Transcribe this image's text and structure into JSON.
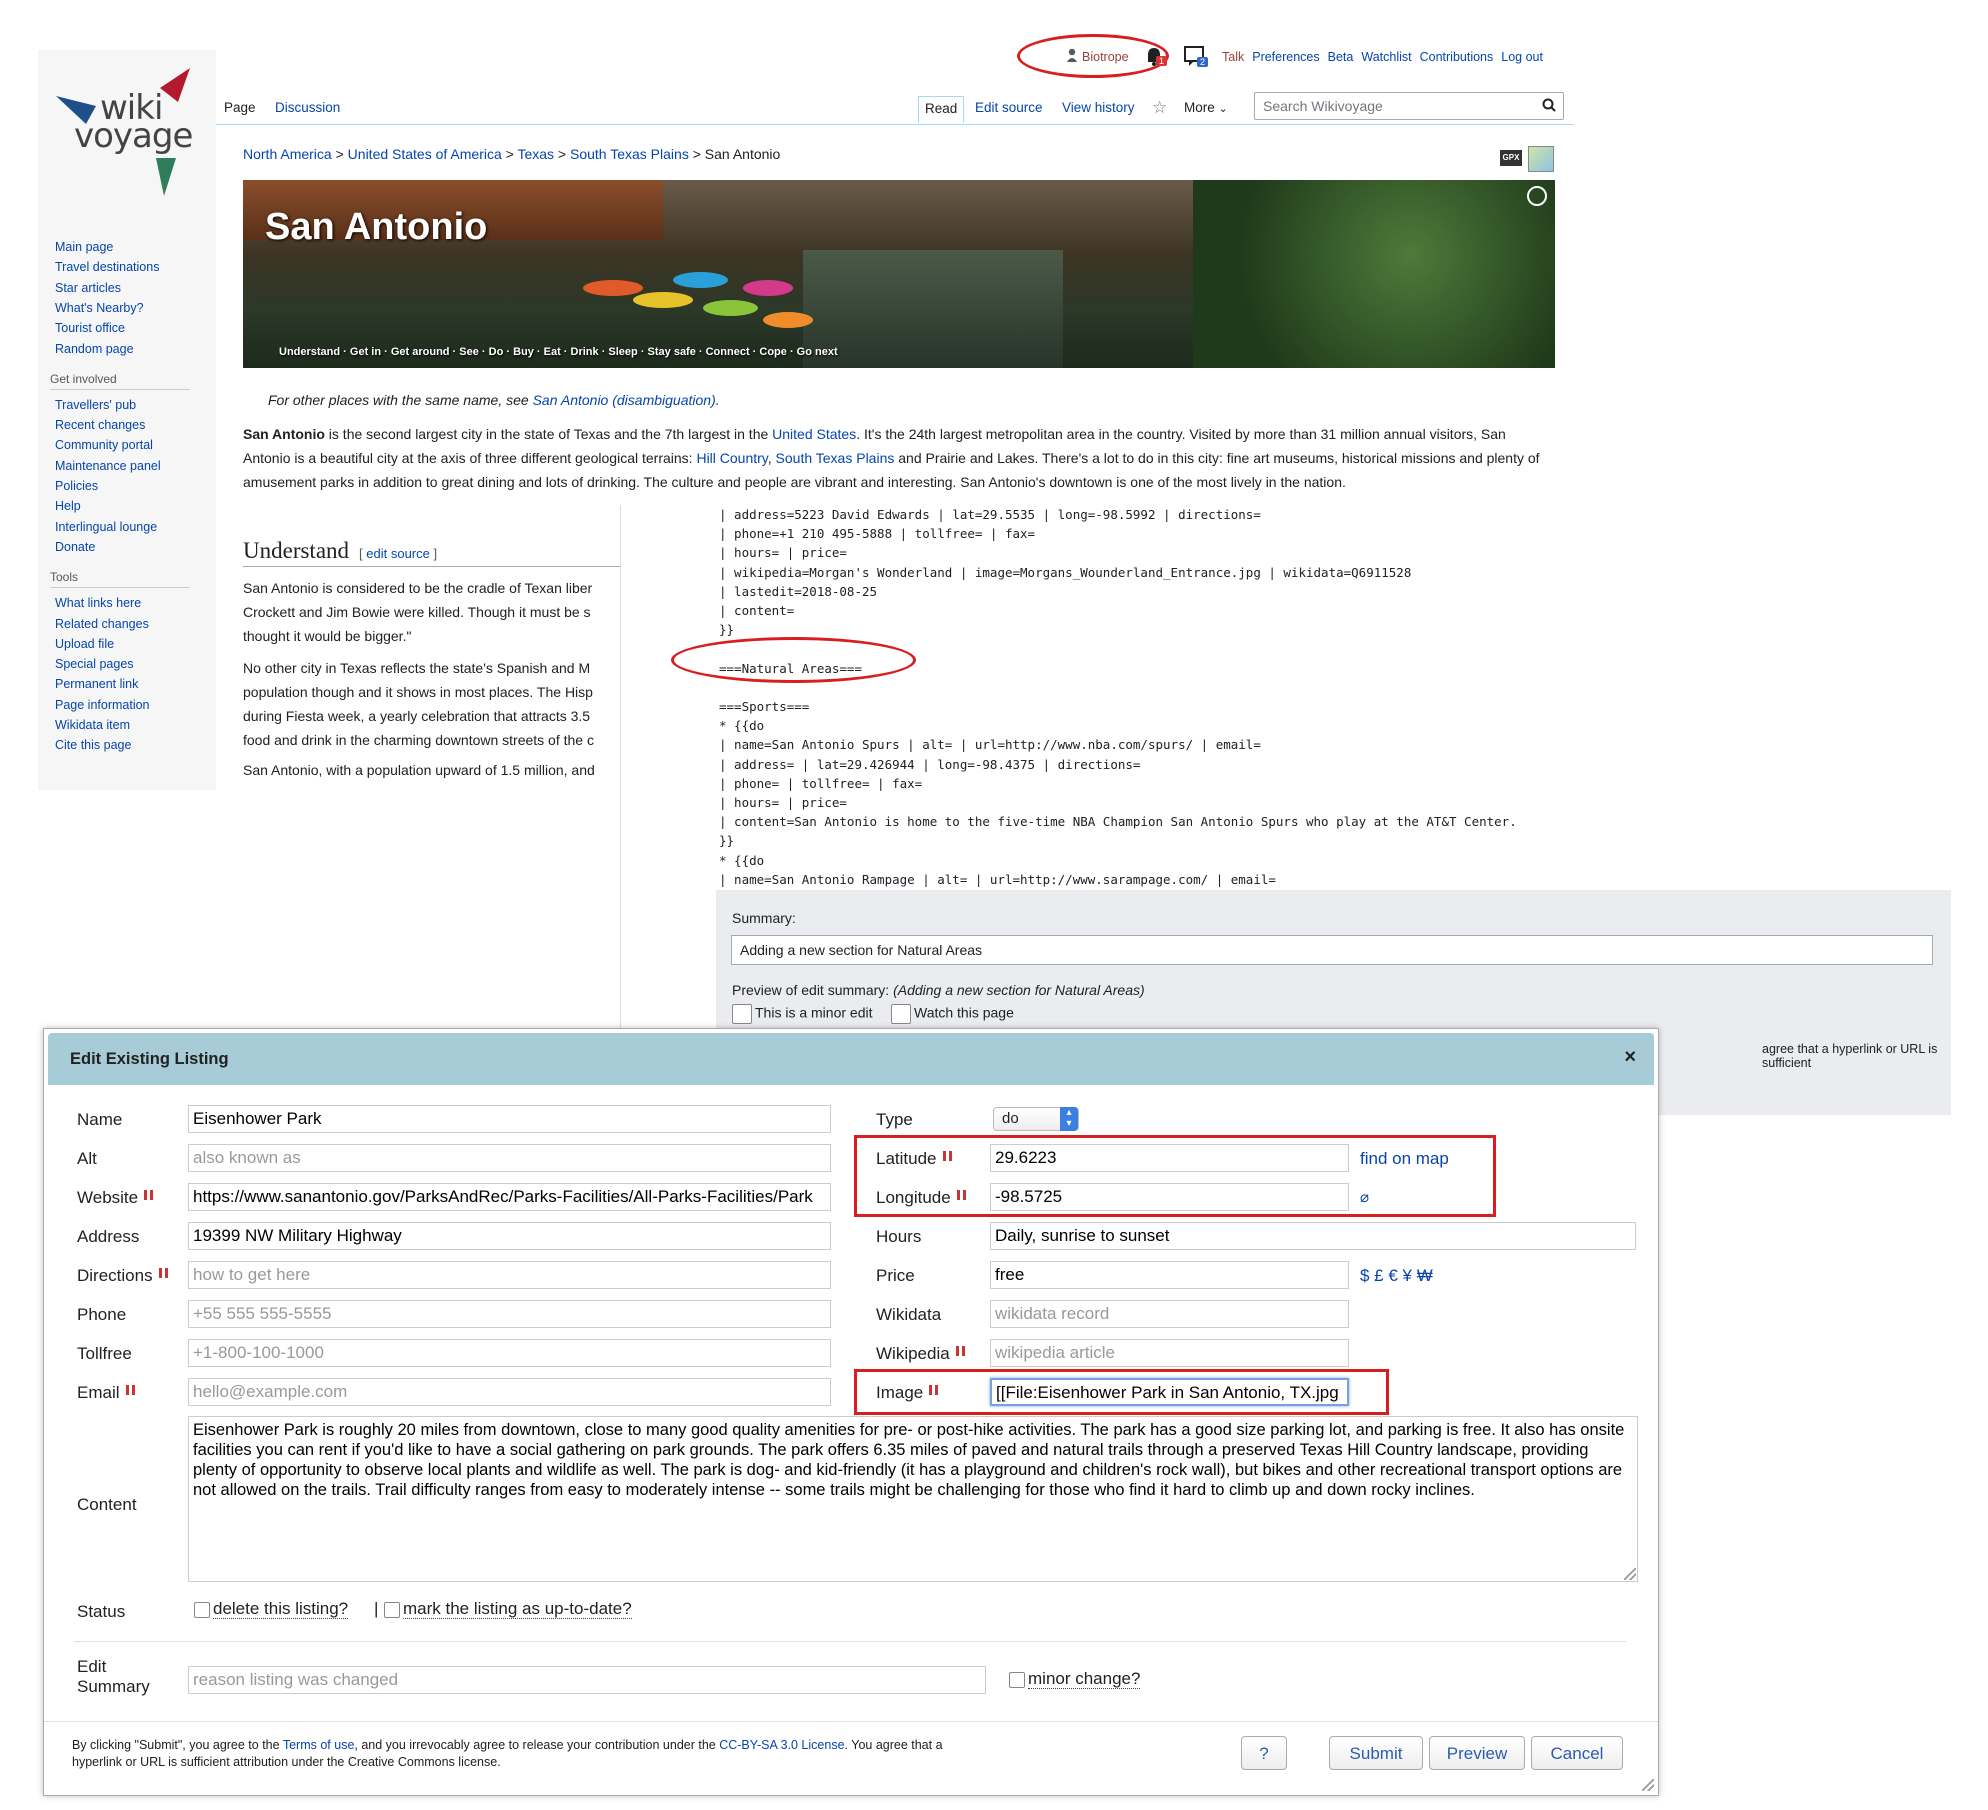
{
  "personal": {
    "username": "Biotrope",
    "notif_alert_count": "1",
    "notif_notice_count": "2",
    "links": [
      "Talk",
      "Preferences",
      "Beta",
      "Watchlist",
      "Contributions",
      "Log out"
    ]
  },
  "logo": {
    "line1": "wiki",
    "line2": "voyage"
  },
  "sidebar": {
    "nav": [
      "Main page",
      "Travel destinations",
      "Star articles",
      "What's Nearby?",
      "Tourist office",
      "Random page"
    ],
    "get_involved_title": "Get involved",
    "get_involved": [
      "Travellers' pub",
      "Recent changes",
      "Community portal",
      "Maintenance panel",
      "Policies",
      "Help",
      "Interlingual lounge",
      "Donate"
    ],
    "tools_title": "Tools",
    "tools": [
      "What links here",
      "Related changes",
      "Upload file",
      "Special pages",
      "Permanent link",
      "Page information",
      "Wikidata item",
      "Cite this page"
    ]
  },
  "tabs": {
    "left": [
      "Page",
      "Discussion"
    ],
    "right": [
      "Read",
      "Edit source",
      "View history"
    ],
    "more": "More",
    "search_placeholder": "Search Wikivoyage"
  },
  "breadcrumb": [
    "North America",
    "United States of America",
    "Texas",
    "South Texas Plains",
    "San Antonio"
  ],
  "gpx_label": "GPX",
  "banner": {
    "title": "San Antonio",
    "toc": "Understand · Get in · Get around · See · Do · Buy · Eat · Drink · Sleep · Stay safe · Connect · Cope · Go next"
  },
  "article": {
    "hatnote_prefix": "For other places with the same name, see ",
    "hatnote_link": "San Antonio (disambiguation)",
    "hatnote_suffix": ".",
    "lead_bold": "San Antonio",
    "lead_1": " is the second largest city in the state of Texas and the 7th largest in the ",
    "lead_link1": "United States",
    "lead_2": ". It's the 24th largest metropolitan area in the country. Visited by more than 31 million annual visitors, San Antonio is a beautiful city at the axis of three different geological terrains: ",
    "lead_link2": "Hill Country",
    "lead_3": ", ",
    "lead_link3": "South Texas Plains",
    "lead_4": " and Prairie and Lakes. There's a lot to do in this city: fine art museums, historical missions and plenty of amusement parks in addition to great dining and lots of drinking. The culture and people are vibrant and interesting. San Antonio's downtown is one of the most lively in the nation.",
    "understand_heading": "Understand",
    "edit_source": "edit source",
    "para1_line1": "San Antonio is considered to be the cradle of Texan liber",
    "para1_line2": "Crockett and Jim Bowie were killed. Though it must be s",
    "para1_line3": "thought it would be bigger.\"",
    "para2_line1": "No other city in Texas reflects the state's Spanish and M",
    "para2_line2": "population though and it shows in most places. The Hisp",
    "para2_line3": "during Fiesta week, a yearly celebration that attracts 3.5",
    "para2_line4": "food and drink in the charming downtown streets of the c",
    "para3_line1": "San Antonio, with a population upward of 1.5 million, and"
  },
  "editor": {
    "code": "| address=5223 David Edwards | lat=29.5535 | long=-98.5992 | directions=\n| phone=+1 210 495-5888 | tollfree= | fax=\n| hours= | price=\n| wikipedia=Morgan's Wonderland | image=Morgans_Wounderland_Entrance.jpg | wikidata=Q6911528\n| lastedit=2018-08-25\n| content=\n}}\n\n===Natural Areas===\n\n===Sports===\n* {{do\n| name=San Antonio Spurs | alt= | url=http://www.nba.com/spurs/ | email=\n| address= | lat=29.426944 | long=-98.4375 | directions=\n| phone= | tollfree= | fax=\n| hours= | price=\n| content=San Antonio is home to the five-time NBA Champion San Antonio Spurs who play at the AT&T Center.\n}}\n* {{do\n| name=San Antonio Rampage | alt= | url=http://www.sarampage.com/ | email=\n| address= | lat= | long= | directions=",
    "summary_label": "Summary:",
    "summary_value": "Adding a new section for Natural Areas",
    "preview_label": "Preview of edit summary:",
    "preview_value": "(Adding a new section for Natural Areas)",
    "minor_edit": "This is a minor edit",
    "watch_page": "Watch this page",
    "license_fragment": "agree that a hyperlink or URL is sufficient"
  },
  "dialog": {
    "title": "Edit Existing Listing",
    "close": "×",
    "labels": {
      "name": "Name",
      "alt": "Alt",
      "website": "Website",
      "address": "Address",
      "directions": "Directions",
      "phone": "Phone",
      "tollfree": "Tollfree",
      "email": "Email",
      "content": "Content",
      "status": "Status",
      "edit_summary_1": "Edit",
      "edit_summary_2": "Summary",
      "type": "Type",
      "latitude": "Latitude",
      "longitude": "Longitude",
      "hours": "Hours",
      "price": "Price",
      "wikidata": "Wikidata",
      "wikipedia": "Wikipedia",
      "image": "Image"
    },
    "values": {
      "name": "Eisenhower Park",
      "website": "https://www.sanantonio.gov/ParksAndRec/Parks-Facilities/All-Parks-Facilities/Park",
      "address": "19399 NW Military Highway",
      "type": "do",
      "latitude": "29.6223",
      "longitude": "-98.5725",
      "hours": "Daily, sunrise to sunset",
      "price": "free",
      "image": "[[File:Eisenhower Park in San Antonio, TX.jpg",
      "content": "Eisenhower Park is roughly 20 miles from downtown, close to many good quality amenities for pre- or post-hike activities. The park has a good size parking lot, and parking is free. It also has onsite facilities you can rent if you'd like to have a social gathering on park grounds. The park offers 6.35 miles of paved and natural trails through a preserved Texas Hill Country landscape, providing plenty of opportunity to observe local plants and wildlife as well. The park is dog- and kid-friendly (it has a playground and children's rock wall), but bikes and other recreational transport options are not allowed on the trails. Trail difficulty ranges from easy to moderately intense -- some trails might be challenging for those who find it hard to climb up and down rocky inclines."
    },
    "placeholders": {
      "alt": "also known as",
      "directions": "how to get here",
      "phone": "+55 555 555-5555",
      "tollfree": "+1-800-100-1000",
      "email": "hello@example.com",
      "wikidata": "wikidata record",
      "wikipedia": "wikipedia article",
      "edit_summary": "reason listing was changed"
    },
    "find_on_map": "find on map",
    "clear_coords": "⌀",
    "currency": "$ £ € ¥ ₩",
    "delete_listing": "delete this listing?",
    "separator": "|",
    "mark_uptodate": "mark the listing as up-to-date?",
    "minor_change": "minor change?",
    "footer_1": "By clicking \"Submit\", you agree to the ",
    "footer_terms": "Terms of use",
    "footer_2": ", and you irrevocably agree to release your contribution under the ",
    "footer_license": "CC-BY-SA 3.0 License",
    "footer_3": ". You agree that a",
    "footer_line2": "hyperlink or URL is sufficient attribution under the Creative Commons license.",
    "buttons": {
      "help": "?",
      "submit": "Submit",
      "preview": "Preview",
      "cancel": "Cancel"
    }
  },
  "colors": {
    "highlight_red": "#d81e1e",
    "dialog_header": "#a8ccd7",
    "link": "#0645ad"
  }
}
